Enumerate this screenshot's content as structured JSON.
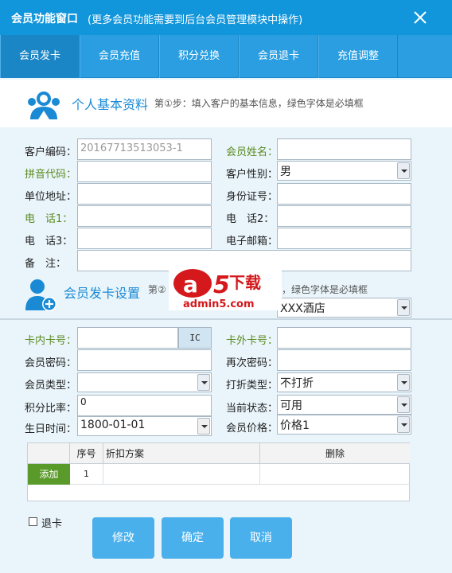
{
  "window": {
    "title": "会员功能窗口",
    "subtitle": "(更多会员功能需要到后台会员管理模块中操作)"
  },
  "tabs": [
    {
      "label": "会员发卡",
      "active": true
    },
    {
      "label": "会员充值"
    },
    {
      "label": "积分兑换"
    },
    {
      "label": "会员退卡"
    },
    {
      "label": "充值调整"
    }
  ],
  "personal": {
    "section_title": "个人基本资料",
    "section_desc": "第①步：填入客户的基本信息，绿色字体是必填框",
    "customer_code_label": "客户编码：",
    "customer_code_value": "20167713513053-1",
    "member_name_label": "会员姓名：",
    "pinyin_label": "拼音代码：",
    "gender_label": "客户性别：",
    "gender_value": "男",
    "company_address_label": "单位地址：",
    "id_number_label": "身份证号：",
    "phone1_label": "电　话1：",
    "phone2_label": "电　话2：",
    "phone3_label": "电　话3：",
    "email_label": "电子邮箱：",
    "note_label": "备　注："
  },
  "card": {
    "section_title": "会员发卡设置",
    "section_desc_prefix": "第②",
    "section_desc_suffix": "，绿色字体是必填框",
    "hotel_value": "XXX酒店",
    "inner_card_label": "卡内卡号：",
    "ic_button": "IC",
    "outer_card_label": "卡外卡号：",
    "password_label": "会员密码：",
    "confirm_password_label": "再次密码：",
    "member_type_label": "会员类型：",
    "discount_type_label": "打折类型：",
    "discount_type_value": "不打折",
    "points_ratio_label": "积分比率：",
    "points_ratio_value": "0",
    "status_label": "当前状态：",
    "status_value": "可用",
    "birthday_label": "生日时间：",
    "birthday_value": "1800-01-01",
    "price_label": "会员价格：",
    "price_value": "价格1"
  },
  "grid": {
    "columns": [
      "序号",
      "折扣方案",
      "删除"
    ],
    "add_label": "添加",
    "rows": [
      {
        "index": "1",
        "plan": "",
        "delete": ""
      }
    ]
  },
  "footer": {
    "return_card_label": "退卡",
    "modify_button": "修改",
    "confirm_button": "确定",
    "cancel_button": "取消"
  },
  "watermark": {
    "logo": "a5下载",
    "url": "admin5.com"
  },
  "colors": {
    "titlebar": "#1296db",
    "accent": "#1a8ad4",
    "required_label": "#5a8a1e",
    "button": "#4ab0ec",
    "add_button": "#5a9a2a"
  }
}
